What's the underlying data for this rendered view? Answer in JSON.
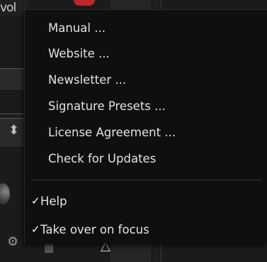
{
  "background": {
    "title_fragment": "vol",
    "icons": {
      "stepper": "up-down-arrows-icon",
      "settings": "gear-icon",
      "cart": "cart-icon",
      "eject": "eject-triangle-icon"
    }
  },
  "menu": {
    "items": [
      {
        "label": "Manual ..."
      },
      {
        "label": "Website ..."
      },
      {
        "label": "Newsletter ..."
      },
      {
        "label": "Signature Presets ..."
      },
      {
        "label": "License Agreement ..."
      },
      {
        "label": "Check for Updates"
      }
    ],
    "toggles": [
      {
        "label": "Help",
        "checked": true,
        "check_mark": "✓"
      },
      {
        "label": "Take over on focus",
        "checked": true,
        "check_mark": "✓"
      }
    ]
  },
  "colors": {
    "menu_bg": "#0f0f0f",
    "menu_text": "#e4e4e4",
    "separator": "#3a3a3a",
    "accent_red": "#c0272d"
  }
}
